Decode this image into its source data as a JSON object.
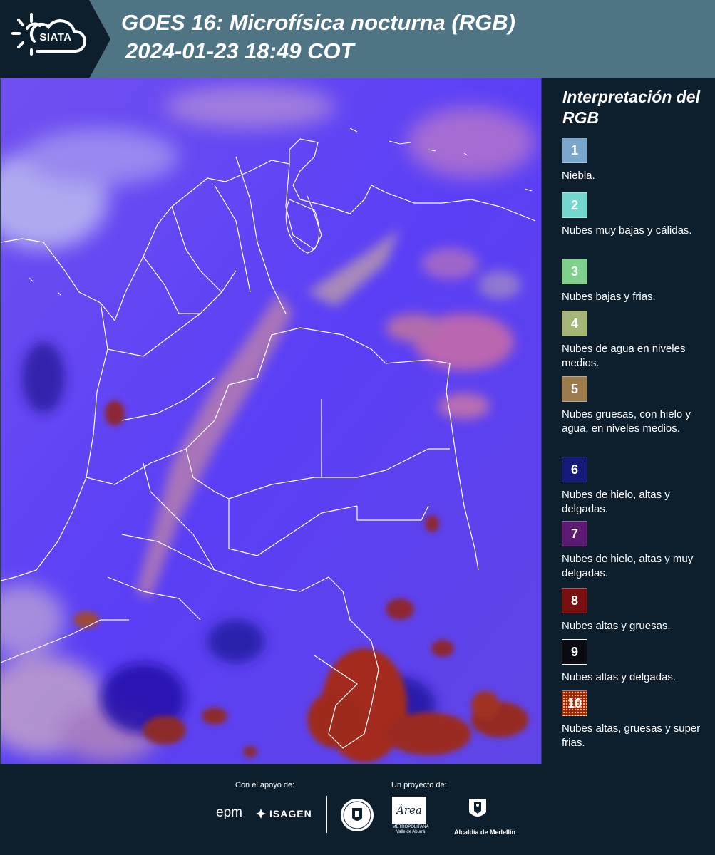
{
  "header": {
    "logo_text": "SIATA",
    "title_line1": "GOES 16: Microfísica nocturna (RGB)",
    "title_line2": "2024-01-23 18:49 COT"
  },
  "legend": {
    "title": "Interpretación del RGB",
    "items": [
      {
        "number": "1",
        "label": "Niebla.",
        "color": "#7ba7cc"
      },
      {
        "number": "2",
        "label": "Nubes muy bajas y cálidas.",
        "color": "#74d7cf"
      },
      {
        "number": "3",
        "label": "Nubes bajas y frias.",
        "color": "#7fd08a"
      },
      {
        "number": "4",
        "label": "Nubes de agua en niveles medios.",
        "color": "#a6b677"
      },
      {
        "number": "5",
        "label": "Nubes gruesas, con hielo y agua, en niveles medios.",
        "color": "#9c7b4d"
      },
      {
        "number": "6",
        "label": "Nubes de hielo, altas y delgadas.",
        "color": "#151a78"
      },
      {
        "number": "7",
        "label": "Nubes de hielo, altas y muy delgadas.",
        "color": "#5c1a72"
      },
      {
        "number": "8",
        "label": "Nubes altas y gruesas.",
        "color": "#7a0f10"
      },
      {
        "number": "9",
        "label": "Nubes altas y delgadas.",
        "color": "#0a0a12"
      },
      {
        "number": "10",
        "label": "Nubes altas, gruesas y super frias.",
        "color": "#a11d12"
      }
    ]
  },
  "footer": {
    "support_label": "Con el apoyo de:",
    "project_label": "Un proyecto de:",
    "epm": "epm",
    "isagen": "ISAGEN",
    "area_logo": "Área",
    "area_sub": "METROPOLITANA Valle de Aburrá",
    "medellin": "Alcaldía de Medellín"
  }
}
